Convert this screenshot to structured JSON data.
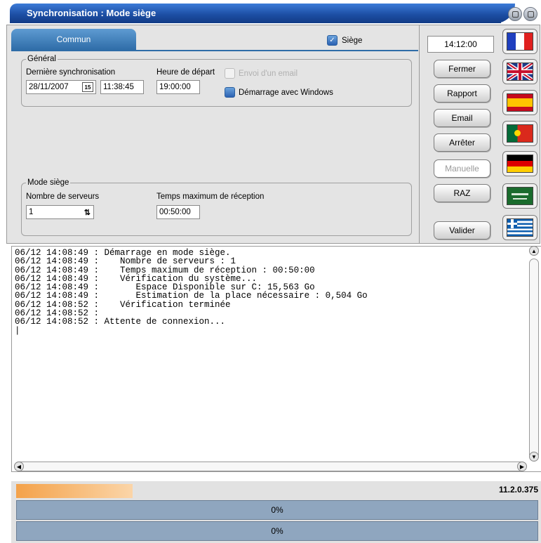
{
  "window": {
    "title": "Synchronisation : Mode siège"
  },
  "tabs": {
    "commun": "Commun",
    "siege_label": "Siège",
    "siege_checked": true
  },
  "general": {
    "legend": "Général",
    "derniere_sync_label": "Dernière synchronisation",
    "date_value": "28/11/2007",
    "time_value": "11:38:45",
    "calendar_icon_text": "15",
    "heure_depart_label": "Heure de départ",
    "heure_depart_value": "19:00:00",
    "envoi_email_label": "Envoi d'un email",
    "envoi_email_checked": false,
    "demarrage_windows_label": "Démarrage avec Windows",
    "demarrage_windows_checked": true
  },
  "mode": {
    "legend": "Mode siège",
    "nb_serveurs_label": "Nombre de serveurs",
    "nb_serveurs_value": "1",
    "temps_max_label": "Temps maximum de réception",
    "temps_max_value": "00:50:00"
  },
  "right": {
    "clock": "14:12:00",
    "buttons": [
      {
        "label": "Fermer",
        "enabled": true
      },
      {
        "label": "Rapport",
        "enabled": true
      },
      {
        "label": "Email",
        "enabled": true
      },
      {
        "label": "Arrêter",
        "enabled": true
      },
      {
        "label": "Manuelle",
        "enabled": false
      },
      {
        "label": "RAZ",
        "enabled": true
      },
      {
        "label": "Valider",
        "enabled": true
      }
    ],
    "flags": [
      "france",
      "united-kingdom",
      "spain",
      "portugal",
      "germany",
      "saudi-arabia",
      "greece"
    ]
  },
  "log": {
    "lines": [
      "06/12 14:08:49 : Démarrage en mode siège.",
      "06/12 14:08:49 :    Nombre de serveurs : 1",
      "06/12 14:08:49 :    Temps maximum de réception : 00:50:00",
      "06/12 14:08:49 :    Vérification du système...",
      "06/12 14:08:49 :       Espace Disponible sur C: 15,563 Go",
      "06/12 14:08:49 :       Estimation de la place nécessaire : 0,504 Go",
      "06/12 14:08:52 :    Vérification terminée",
      "06/12 14:08:52 :",
      "06/12 14:08:52 : Attente de connexion..."
    ]
  },
  "status": {
    "version": "11.2.0.375",
    "mini_progress_fraction": 0.22,
    "progress1": "0%",
    "progress2": "0%"
  },
  "colors": {
    "title_bar": "#1d4fa5",
    "tab": "#2f6da8",
    "progress_bar": "#8fa6bf",
    "mini_progress": "#f4a24a"
  }
}
